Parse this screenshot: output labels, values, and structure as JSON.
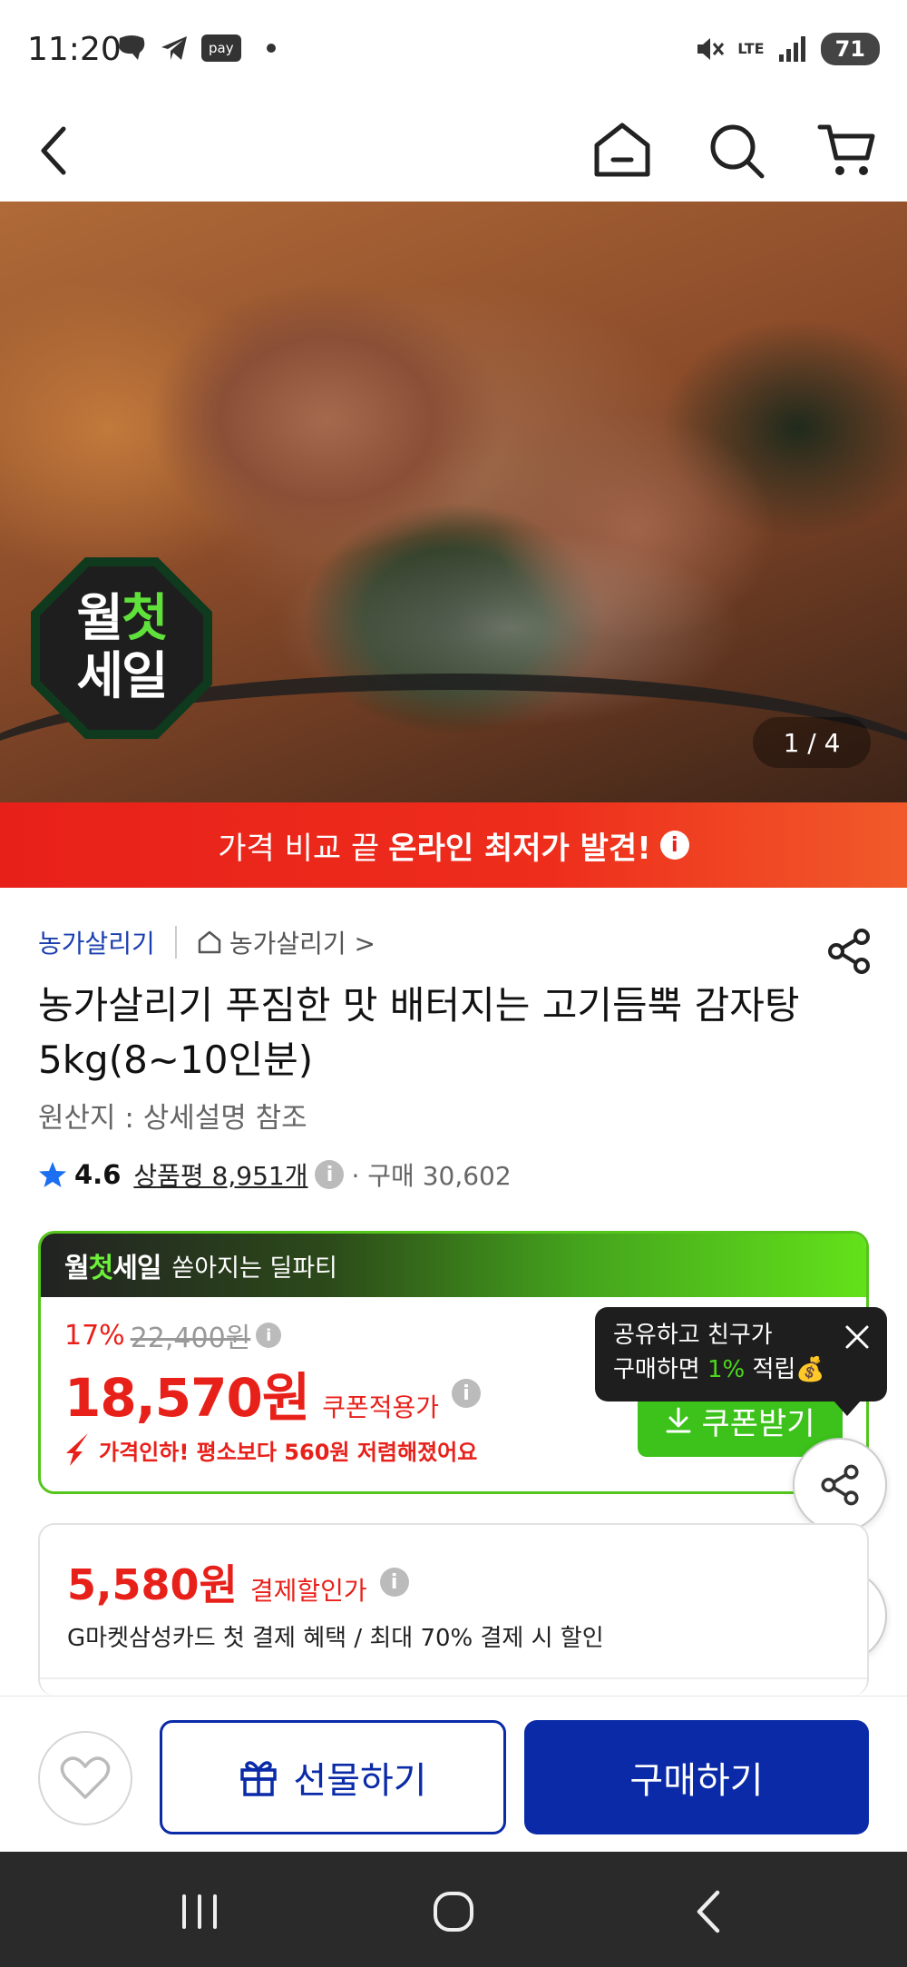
{
  "status_bar": {
    "time": "11:20",
    "pay_badge": "pay",
    "network": "LTE",
    "battery": "71",
    "icons": [
      "chat-icon",
      "telegram-icon",
      "pay-icon",
      "mute-icon",
      "signal-icon"
    ]
  },
  "header": {
    "icons": [
      "back-icon",
      "home-icon",
      "search-icon",
      "cart-icon"
    ]
  },
  "hero": {
    "badge_line1_a": "월",
    "badge_line1_b": "첫",
    "badge_line2": "세일",
    "counter": "1 / 4"
  },
  "promo_banner": {
    "text_normal": "가격 비교 끝",
    "text_bold": "온라인 최저가 발견!",
    "info": "i"
  },
  "product": {
    "seller": "농가살리기",
    "store_link": "농가살리기 >",
    "title": "농가살리기 푸짐한 맛 배터지는 고기듬뿍 감자탕 5kg(8~10인분)",
    "origin": "원산지 : 상세설명 참조",
    "rating": "4.6",
    "review_label": "상품평 8,951개",
    "purchase": "· 구매 30,602"
  },
  "deal": {
    "logo_a": "월",
    "logo_b": "첫",
    "logo_c": "세일",
    "subtitle": "쏟아지는 딜파티",
    "discount": "17%",
    "original_price": "22,400원",
    "price": "18,570원",
    "price_tag": "쿠폰적용가",
    "price_drop": "가격인하! 평소보다 560원 저렴해졌어요",
    "coupon_button": "쿠폰받기"
  },
  "tooltip": {
    "line1": "공유하고 친구가",
    "line2_a": "구매하면 ",
    "line2_b": "1%",
    "line2_c": " 적립💰"
  },
  "payment": {
    "price": "5,580원",
    "tag": "결제할인가",
    "desc": "G마켓삼성카드 첫 결제 혜택 / 최대 70% 결제 시 할인"
  },
  "bottom_bar": {
    "gift_label": "선물하기",
    "buy_label": "구매하기"
  },
  "colors": {
    "brand_blue": "#0a2aa8",
    "sale_red": "#e8201a",
    "deal_green": "#3cc21a"
  }
}
